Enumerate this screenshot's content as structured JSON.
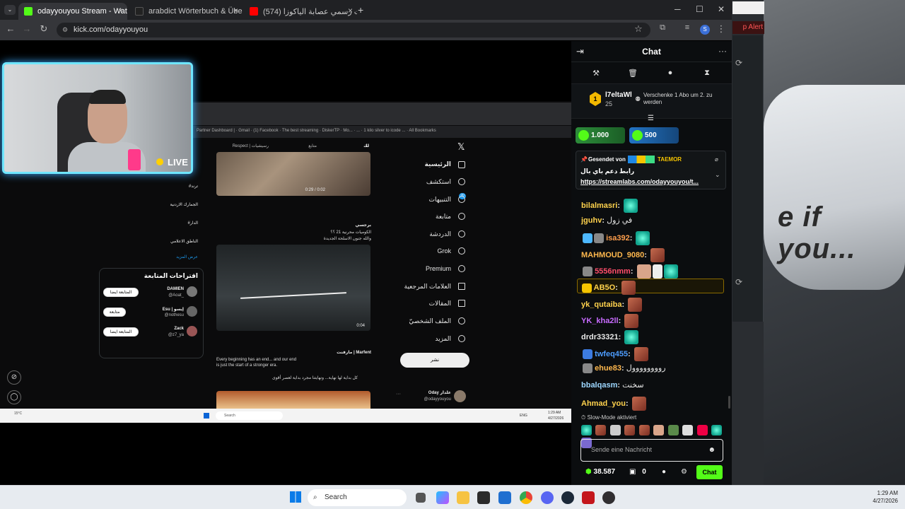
{
  "browser": {
    "tabs": [
      {
        "label": "odayyouyou Stream - Watch",
        "active": true
      },
      {
        "label": "arabdict Wörterbuch & Überset",
        "active": false
      },
      {
        "label": "(574) فايت رسمي عصابة الياكوزا",
        "active": false
      }
    ],
    "new_tab_label": "+",
    "url": "kick.com/odayyouyou"
  },
  "background_window": {
    "alert_label": "p Alert",
    "car_text": "e if you..."
  },
  "stream": {
    "live_label": "LIVE",
    "inner_page": {
      "x_nav": [
        "الرئيسية",
        "استكشف",
        "التنبيهات",
        "متابعة",
        "الدردشة",
        "Grok",
        "Premium",
        "العلامات المرجعية",
        "المقالات",
        "الملف الشخصيّ",
        "المزيد"
      ],
      "post_button": "نشر",
      "notification_badge": "20",
      "profile_name": "Oday علدار",
      "profile_handle": "@odayyouyou",
      "feed_tabs": [
        "لك",
        "متابع",
        "Respect | رسيشيات"
      ],
      "follow_header": "اقتراحات المتابعة",
      "follow_suggestions": [
        {
          "name": "DAMIEN",
          "handle": "@Aoat_",
          "button": "المتابعة ايضا"
        },
        {
          "name": "Esu | إيسو",
          "handle": "@nothesu",
          "button": "متابعة"
        },
        {
          "name": "Zack",
          "handle": "@z7_ya",
          "button": "المتابعة ايضا"
        }
      ],
      "show_more": "عرض المزيد",
      "trends": [
        "#ترند",
        "الجمارك الاردنية",
        "#الدار",
        "الناطق الاعلامي"
      ],
      "tweet1_author": "برجسي",
      "tweet1_text": "الكوميات محرنية 21 ؟؟",
      "tweet1_sub": "والله جنون الاسلحة الجديدة",
      "tweet2_author": "مارفنت | Marfent",
      "tweet2_text": "Every beginning has an end... and our end is just the start of a stronger era.",
      "tweet2_arabic": "كل بداية لها نهاية... ونهايتنا مجرد بداية لعصر أقوى",
      "video1_time": "0:29 / 0:02",
      "video2_time": "0:04",
      "search_placeholder": "Search"
    }
  },
  "chat": {
    "title": "Chat",
    "sub": {
      "user": "l7eltaWl",
      "count": "25",
      "text": "Verschenke 1 Abo um 2. zu werden"
    },
    "gifts": [
      "1.000",
      "500"
    ],
    "pinned": {
      "sent_by_label": "Gesendet von",
      "sender": "TAEMOR",
      "text": "رابط دعم باي بال",
      "link": "https://streamlabs.com/odayyouyou/t..."
    },
    "messages": [
      {
        "user": "bilalmasri",
        "color": "#ffd24d",
        "text": ""
      },
      {
        "user": "jguhv",
        "color": "#ffd24d",
        "text": "في زول"
      },
      {
        "user": "isa392",
        "color": "#ff9f4d",
        "text": ""
      },
      {
        "user": "MAHMOUD_9080",
        "color": "#ffb84d",
        "text": ""
      },
      {
        "user": "5556nmm",
        "color": "#ff4d6a",
        "text": ""
      },
      {
        "user": "AB5O",
        "color": "#ffd24d",
        "text": ""
      },
      {
        "user": "yk_qutaiba",
        "color": "#ffd24d",
        "text": ""
      },
      {
        "user": "YK_kha2ll",
        "color": "#c86bff",
        "text": ""
      },
      {
        "user": "drdr33321",
        "color": "#e8e8e8",
        "text": ""
      },
      {
        "user": "twfeq455",
        "color": "#4d9dff",
        "text": ""
      },
      {
        "user": "ehue83",
        "color": "#ffb84d",
        "text": "روووووووول"
      },
      {
        "user": "bbalqasm",
        "color": "#9dd7ff",
        "text": "سخنت"
      },
      {
        "user": "Ahmad_you",
        "color": "#ffd24d",
        "text": ""
      }
    ],
    "slow_mode": "Slow-Mode aktiviert",
    "input_placeholder": "Sende eine Nachricht",
    "points": "38.587",
    "gift_count": "0",
    "send_label": "Chat"
  },
  "taskbar": {
    "search_placeholder": "Search",
    "time": "1:29 AM",
    "date": "4/27/2026",
    "inner_time": "1:29 AM",
    "inner_date": "4/27/2026",
    "weather": "15°C",
    "lang": "ENG"
  },
  "colors": {
    "kick_green": "#53fc18",
    "chat_bg": "#0b0d0f",
    "webcam_border": "#6fe6ff"
  }
}
